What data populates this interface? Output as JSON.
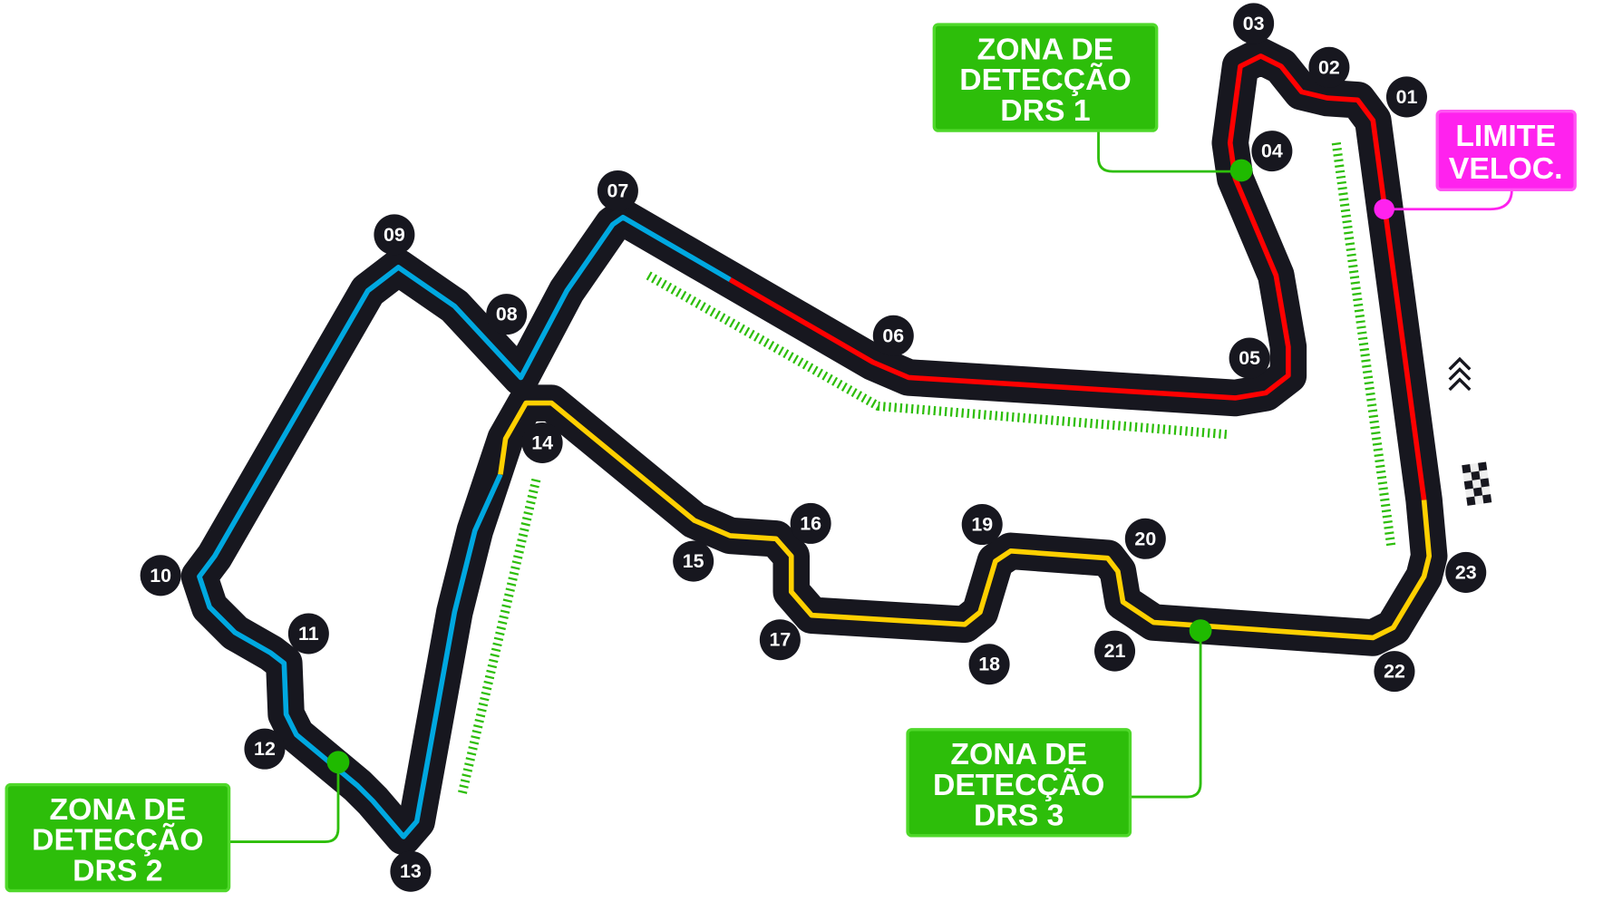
{
  "colors": {
    "track": "#17171f",
    "sector1": "#ff0000",
    "sector2": "#00a8e0",
    "sector3": "#ffd000",
    "drs": "#2dbe0a",
    "speed_limit": "#ff22ee"
  },
  "corners": [
    "01",
    "02",
    "03",
    "04",
    "05",
    "06",
    "07",
    "08",
    "09",
    "10",
    "11",
    "12",
    "13",
    "14",
    "15",
    "16",
    "17",
    "18",
    "19",
    "20",
    "21",
    "22",
    "23"
  ],
  "drs_zones": [
    {
      "lines": [
        "ZONA DE",
        "DETECÇÃO",
        "DRS 1"
      ]
    },
    {
      "lines": [
        "ZONA DE",
        "DETECÇÃO",
        "DRS 2"
      ]
    },
    {
      "lines": [
        "ZONA DE",
        "DETECÇÃO",
        "DRS 3"
      ]
    }
  ],
  "speed_limit": {
    "lines": [
      "LIMITE",
      "VELOC."
    ]
  },
  "icons": {
    "start_finish": "checkered-flag",
    "direction": "double-chevron-up"
  }
}
